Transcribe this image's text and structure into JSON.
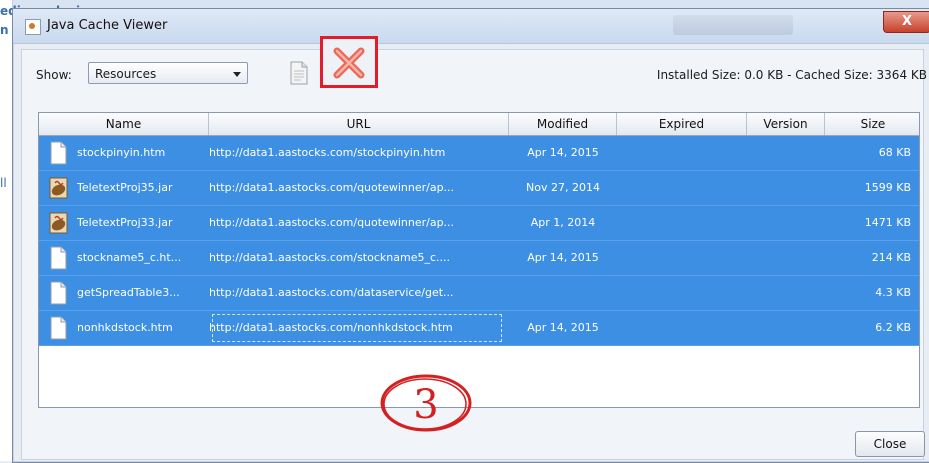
{
  "background": {
    "fragment1": "edia or devices",
    "fragment2": "n",
    "fragment3": "ll"
  },
  "window": {
    "title": "Java Cache Viewer",
    "close_glyph": "X"
  },
  "toolbar": {
    "show_label": "Show:",
    "show_value": "Resources",
    "size_summary": "Installed Size: 0.0 KB - Cached Size: 3364 KB"
  },
  "table": {
    "columns": [
      "Name",
      "URL",
      "Modified",
      "Expired",
      "Version",
      "Size"
    ],
    "rows": [
      {
        "name": "stockpinyin.htm",
        "url": "http://data1.aastocks.com/stockpinyin.htm",
        "modified": "Apr 14, 2015",
        "expired": "",
        "version": "",
        "size": "68 KB",
        "icon": "document-icon"
      },
      {
        "name": "TeletextProj35.jar",
        "url": "http://data1.aastocks.com/quotewinner/ap...",
        "modified": "Nov 27, 2014",
        "expired": "",
        "version": "",
        "size": "1599 KB",
        "icon": "java-jar-icon"
      },
      {
        "name": "TeletextProj33.jar",
        "url": "http://data1.aastocks.com/quotewinner/ap...",
        "modified": "Apr 1, 2014",
        "expired": "",
        "version": "",
        "size": "1471 KB",
        "icon": "java-jar-icon"
      },
      {
        "name": "stockname5_c.ht...",
        "url": "http://data1.aastocks.com/stockname5_c....",
        "modified": "Apr 14, 2015",
        "expired": "",
        "version": "",
        "size": "214 KB",
        "icon": "document-icon"
      },
      {
        "name": "getSpreadTable3...",
        "url": "http://data1.aastocks.com/dataservice/get...",
        "modified": "",
        "expired": "",
        "version": "",
        "size": "4.3 KB",
        "icon": "document-icon"
      },
      {
        "name": "nonhkdstock.htm",
        "url": "http://data1.aastocks.com/nonhkdstock.htm",
        "modified": "Apr 14, 2015",
        "expired": "",
        "version": "",
        "size": "6.2 KB",
        "icon": "document-icon"
      }
    ]
  },
  "annotation": {
    "label": "3",
    "color": "#d42020"
  },
  "buttons": {
    "close_label": "Close"
  },
  "colors": {
    "selection": "#3d8fe4",
    "highlight_box": "#e11d2b"
  }
}
